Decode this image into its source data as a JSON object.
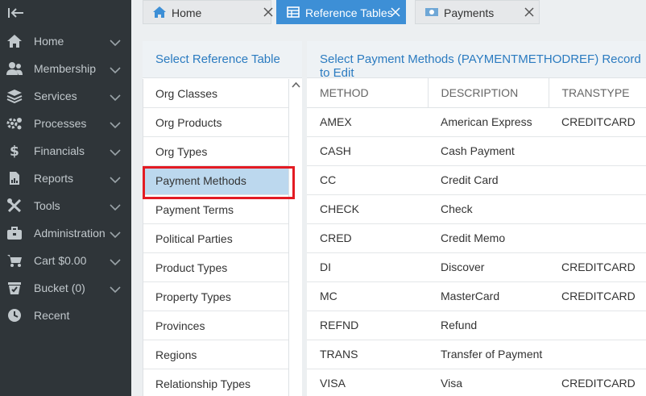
{
  "sidebar": {
    "items": [
      {
        "label": "Home",
        "icon": "home-icon"
      },
      {
        "label": "Membership",
        "icon": "users-icon"
      },
      {
        "label": "Services",
        "icon": "layers-icon"
      },
      {
        "label": "Processes",
        "icon": "gears-icon"
      },
      {
        "label": "Financials",
        "icon": "dollar-icon"
      },
      {
        "label": "Reports",
        "icon": "report-icon"
      },
      {
        "label": "Tools",
        "icon": "tools-icon"
      },
      {
        "label": "Administration",
        "icon": "briefcase-icon"
      },
      {
        "label": "Cart $0.00",
        "icon": "cart-icon"
      },
      {
        "label": "Bucket (0)",
        "icon": "bucket-icon"
      },
      {
        "label": "Recent",
        "icon": "clock-icon"
      }
    ]
  },
  "tabs": [
    {
      "label": "Home",
      "icon": "home-icon",
      "active": false
    },
    {
      "label": "Reference Tables",
      "icon": "table-icon",
      "active": true
    },
    {
      "label": "Payments",
      "icon": "money-icon",
      "active": false
    }
  ],
  "left_panel": {
    "title": "Select Reference Table",
    "items": [
      "Org Classes",
      "Org Products",
      "Org Types",
      "Payment Methods",
      "Payment Terms",
      "Political Parties",
      "Product Types",
      "Property Types",
      "Provinces",
      "Regions",
      "Relationship Types"
    ],
    "selected": "Payment Methods"
  },
  "right_panel": {
    "title": "Select Payment Methods (PAYMENTMETHODREF) Record to Edit",
    "columns": [
      "METHOD",
      "DESCRIPTION",
      "TRANSTYPE"
    ],
    "rows": [
      [
        "AMEX",
        "American Express",
        "CREDITCARD"
      ],
      [
        "CASH",
        "Cash Payment",
        ""
      ],
      [
        "CC",
        "Credit Card",
        ""
      ],
      [
        "CHECK",
        "Check",
        ""
      ],
      [
        "CRED",
        "Credit Memo",
        ""
      ],
      [
        "DI",
        "Discover",
        "CREDITCARD"
      ],
      [
        "MC",
        "MasterCard",
        "CREDITCARD"
      ],
      [
        "REFND",
        "Refund",
        ""
      ],
      [
        "TRANS",
        "Transfer of Payment",
        ""
      ],
      [
        "VISA",
        "Visa",
        "CREDITCARD"
      ]
    ]
  },
  "colors": {
    "sidebar_bg": "#2f3539",
    "accent": "#3d8fd6",
    "title": "#2b7bc0",
    "selection": "#bcd8ee",
    "highlight": "#e31b23"
  }
}
